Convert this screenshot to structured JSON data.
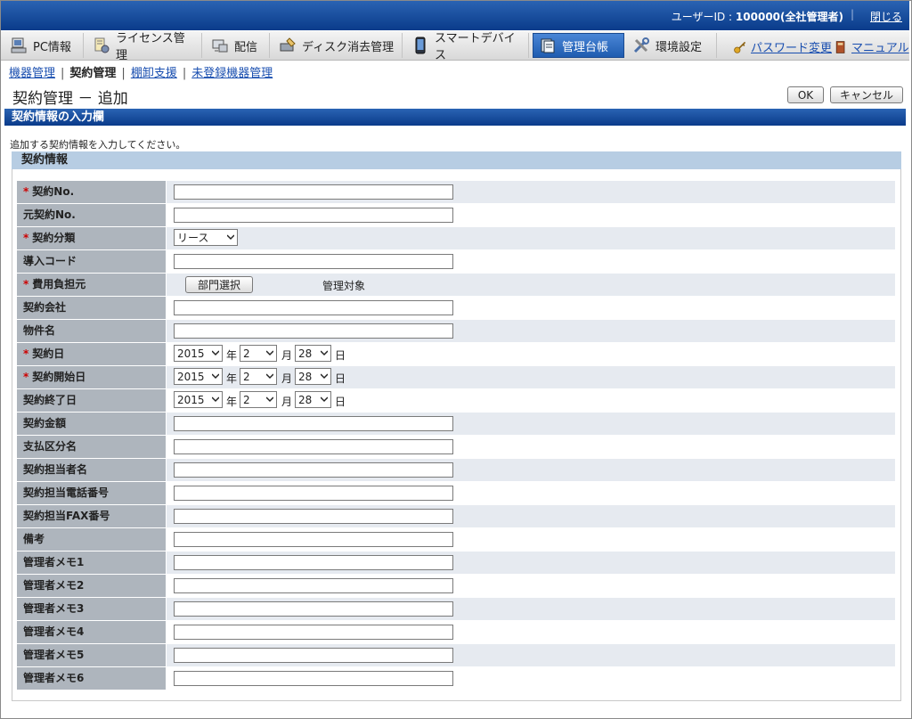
{
  "header": {
    "user_prefix": "ユーザーID : ",
    "user_id": "100000(全社管理者)",
    "logout": "閉じる"
  },
  "nav": {
    "tabs": [
      {
        "label": "PC情報",
        "icon": "pc-icon"
      },
      {
        "label": "ライセンス管理",
        "icon": "license-icon"
      },
      {
        "label": "配信",
        "icon": "distribution-icon"
      },
      {
        "label": "ディスク消去管理",
        "icon": "disk-erase-icon"
      },
      {
        "label": "スマートデバイス",
        "icon": "smart-device-icon"
      },
      {
        "label": "管理台帳",
        "icon": "ledger-icon"
      },
      {
        "label": "環境設定",
        "icon": "settings-tools-icon"
      }
    ],
    "active_tab": "管理台帳",
    "password_link": "パスワード変更",
    "manual_link": "マニュアル"
  },
  "subnav": {
    "items": [
      "機器管理",
      "契約管理",
      "棚卸支援",
      "未登録機器管理"
    ],
    "current": "契約管理"
  },
  "page": {
    "title": "契約管理 － 追加",
    "ok_button": "OK",
    "cancel_button": "キャンセル"
  },
  "section": {
    "header": "契約情報の入力欄",
    "instruction": "追加する契約情報を入力してください。",
    "subheader": "契約情報"
  },
  "form": {
    "required_mark": "*",
    "contract_no": "契約No.",
    "original_contract_no": "元契約No.",
    "contract_type": "契約分類",
    "contract_type_value": "リース",
    "introduction_code": "導入コード",
    "cost_bearer": "費用負担元",
    "dept_select_button": "部門選択",
    "cost_bearer_value": "管理対象",
    "contract_company": "契約会社",
    "property_name": "物件名",
    "contract_date": "契約日",
    "contract_start_date": "契約開始日",
    "contract_end_date": "契約終了日",
    "date_year": "2015",
    "date_month": "2",
    "date_day": "28",
    "unit_year": "年",
    "unit_month": "月",
    "unit_day": "日",
    "contract_amount": "契約金額",
    "payment_category": "支払区分名",
    "contact_person": "契約担当者名",
    "contact_phone": "契約担当電話番号",
    "contact_fax": "契約担当FAX番号",
    "remarks": "備考",
    "memo1": "管理者メモ1",
    "memo2": "管理者メモ2",
    "memo3": "管理者メモ3",
    "memo4": "管理者メモ4",
    "memo5": "管理者メモ5",
    "memo6": "管理者メモ6"
  }
}
